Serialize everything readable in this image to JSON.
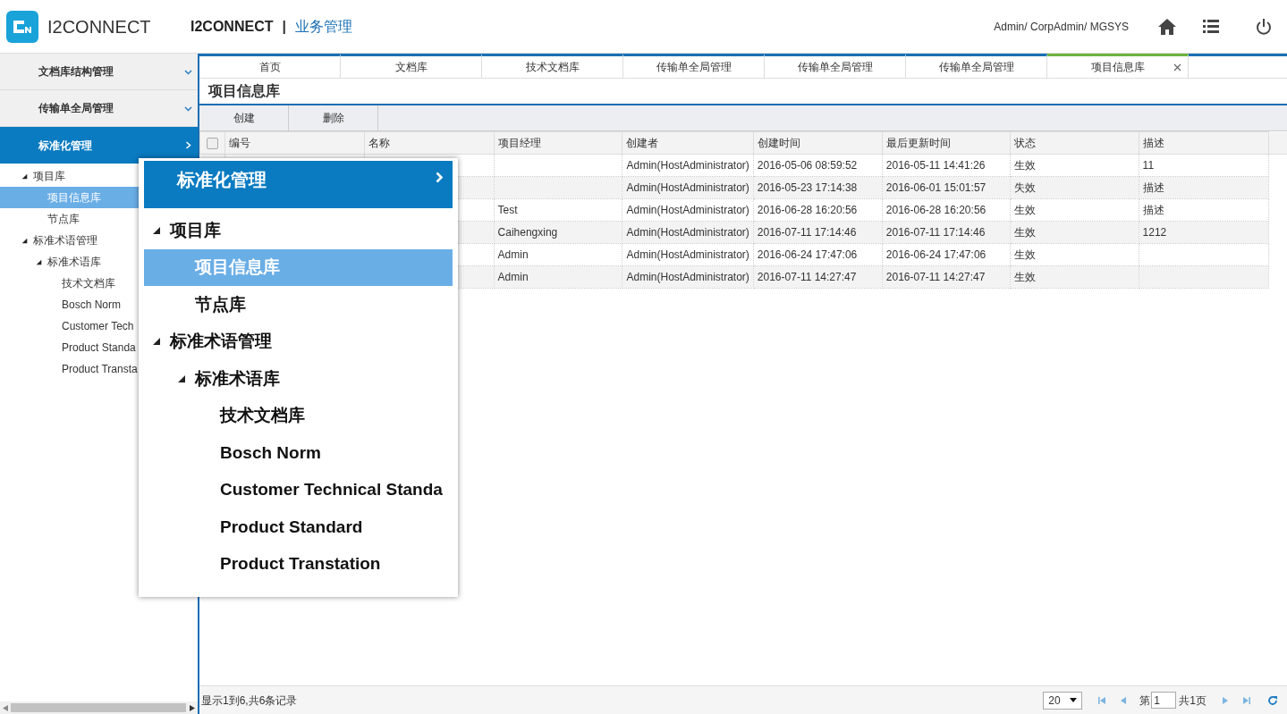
{
  "header": {
    "logo_text": "I2CONNECT",
    "app_name": "I2CONNECT",
    "separator": "|",
    "module": "业务管理",
    "user": "Admin/ CorpAdmin/ MGSYS"
  },
  "sidebar": {
    "menus": [
      {
        "label": "文档库结构管理",
        "expanded": false
      },
      {
        "label": "传输单全局管理",
        "expanded": false
      },
      {
        "label": "标准化管理",
        "expanded": true
      }
    ],
    "tree": [
      {
        "label": "项目库",
        "expanded": true,
        "selected": false,
        "children": [
          {
            "label": "项目信息库",
            "selected": true
          },
          {
            "label": "节点库",
            "selected": false
          }
        ]
      },
      {
        "label": "标准术语管理",
        "expanded": true,
        "selected": false,
        "children": [
          {
            "label": "标准术语库",
            "expanded": true,
            "selected": false,
            "children": [
              {
                "label": "技术文档库",
                "selected": false
              },
              {
                "label": "Bosch Norm",
                "selected": false
              },
              {
                "label": "Customer Tech",
                "selected": false
              },
              {
                "label": "Product Standa",
                "selected": false
              },
              {
                "label": "Product Transta",
                "selected": false
              }
            ]
          }
        ]
      }
    ]
  },
  "tabs": [
    {
      "label": "首页",
      "selected": false
    },
    {
      "label": "文档库",
      "selected": false
    },
    {
      "label": "技术文档库",
      "selected": false
    },
    {
      "label": "传输单全局管理",
      "selected": false
    },
    {
      "label": "传输单全局管理",
      "selected": false
    },
    {
      "label": "传输单全局管理",
      "selected": false
    },
    {
      "label": "项目信息库",
      "selected": true,
      "closable": true
    }
  ],
  "page_title": "项目信息库",
  "toolbar": [
    "创建",
    "删除"
  ],
  "table": {
    "columns": [
      "编号",
      "名称",
      "项目经理",
      "创建者",
      "创建时间",
      "最后更新时间",
      "状态",
      "描述"
    ],
    "select_all_checked": false,
    "rows": [
      [
        "",
        "",
        "",
        "Admin(HostAdministrator)",
        "2016-05-06 08:59:52",
        "2016-05-11 14:41:26",
        "生效",
        "11"
      ],
      [
        "",
        "",
        "",
        "Admin(HostAdministrator)",
        "2016-05-23 17:14:38",
        "2016-06-01 15:01:57",
        "失效",
        "描述"
      ],
      [
        "",
        "",
        "Test",
        "Admin(HostAdministrator)",
        "2016-06-28 16:20:56",
        "2016-06-28 16:20:56",
        "生效",
        "描述"
      ],
      [
        "",
        "",
        "Caihengxing",
        "Admin(HostAdministrator)",
        "2016-07-11 17:14:46",
        "2016-07-11 17:14:46",
        "生效",
        "1212"
      ],
      [
        "",
        "",
        "Admin",
        "Admin(HostAdministrator)",
        "2016-06-24 17:47:06",
        "2016-06-24 17:47:06",
        "生效",
        ""
      ],
      [
        "",
        "",
        "Admin",
        "Admin(HostAdministrator)",
        "2016-07-11 14:27:47",
        "2016-07-11 14:27:47",
        "生效",
        ""
      ]
    ]
  },
  "footer": {
    "summary": "显示1到6,共6条记录",
    "page_size": "20",
    "page_label": "第",
    "page": "1",
    "total": "共1页"
  },
  "callout": {
    "header": "标准化管理",
    "tree": [
      {
        "label": "项目库",
        "expanded": true,
        "selected": false,
        "children": [
          {
            "label": "项目信息库",
            "selected": true
          },
          {
            "label": "节点库",
            "selected": false
          }
        ]
      },
      {
        "label": "标准术语管理",
        "expanded": true,
        "selected": false,
        "children": [
          {
            "label": "标准术语库",
            "expanded": true,
            "selected": false,
            "children": [
              {
                "label": "技术文档库",
                "selected": false
              },
              {
                "label": "Bosch Norm",
                "selected": false
              },
              {
                "label": "Customer Technical Standa",
                "selected": false
              },
              {
                "label": "Product Standard",
                "selected": false
              },
              {
                "label": "Product Transtation",
                "selected": false
              }
            ]
          }
        ]
      }
    ]
  }
}
